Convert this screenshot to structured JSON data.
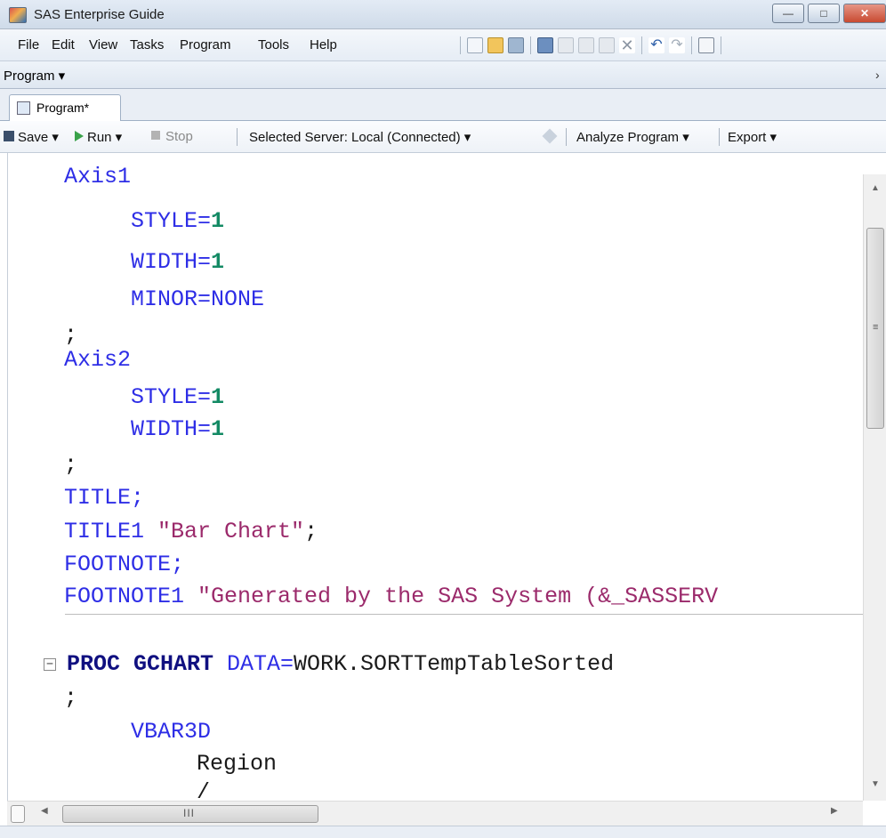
{
  "window": {
    "title": "SAS Enterprise Guide",
    "controls": {
      "minimize": "—",
      "maximize": "□",
      "close": "✕"
    }
  },
  "menu": {
    "items": [
      "File",
      "Edit",
      "View",
      "Tasks",
      "Program",
      "Tools",
      "Help"
    ]
  },
  "program_bar": {
    "label": "Program ▾",
    "overflow": "›"
  },
  "tab": {
    "label": "Program*"
  },
  "program_toolbar": {
    "save": "Save ▾",
    "run": "Run ▾",
    "stop": "Stop",
    "server": "Selected Server: Local (Connected) ▾",
    "analyze": "Analyze Program ▾",
    "export": "Export ▾"
  },
  "colors": {
    "keyword": "#2e2ee6",
    "number": "#138a64",
    "string": "#9b2a6b",
    "proc": "#101080"
  },
  "code": {
    "l1": "Axis1",
    "l2a": "STYLE=",
    "l2b": "1",
    "l3a": "WIDTH=",
    "l3b": "1",
    "l4": "MINOR=NONE",
    "l5": ";",
    "l6": "Axis2",
    "l7a": "STYLE=",
    "l7b": "1",
    "l8a": "WIDTH=",
    "l8b": "1",
    "l9": ";",
    "l10": "TITLE;",
    "l11a": "TITLE1 ",
    "l11b": "\"Bar Chart\"",
    "l11c": ";",
    "l12": "FOOTNOTE;",
    "l13a": "FOOTNOTE1 ",
    "l13b": "\"Generated by the SAS System (&_SASSERV",
    "l14a": "PROC GCHART",
    "l14b": " DATA=",
    "l14c": "WORK.SORTTempTableSorted",
    "l15": ";",
    "l16": "VBAR3D",
    "l17": "Region",
    "l18": "/"
  },
  "scrollbar": {
    "grip": "≡",
    "hgrip": "III"
  },
  "icons": [
    "app-icon",
    "save-icon",
    "run-icon",
    "stop-icon",
    "server-icon",
    "fold-icon"
  ]
}
